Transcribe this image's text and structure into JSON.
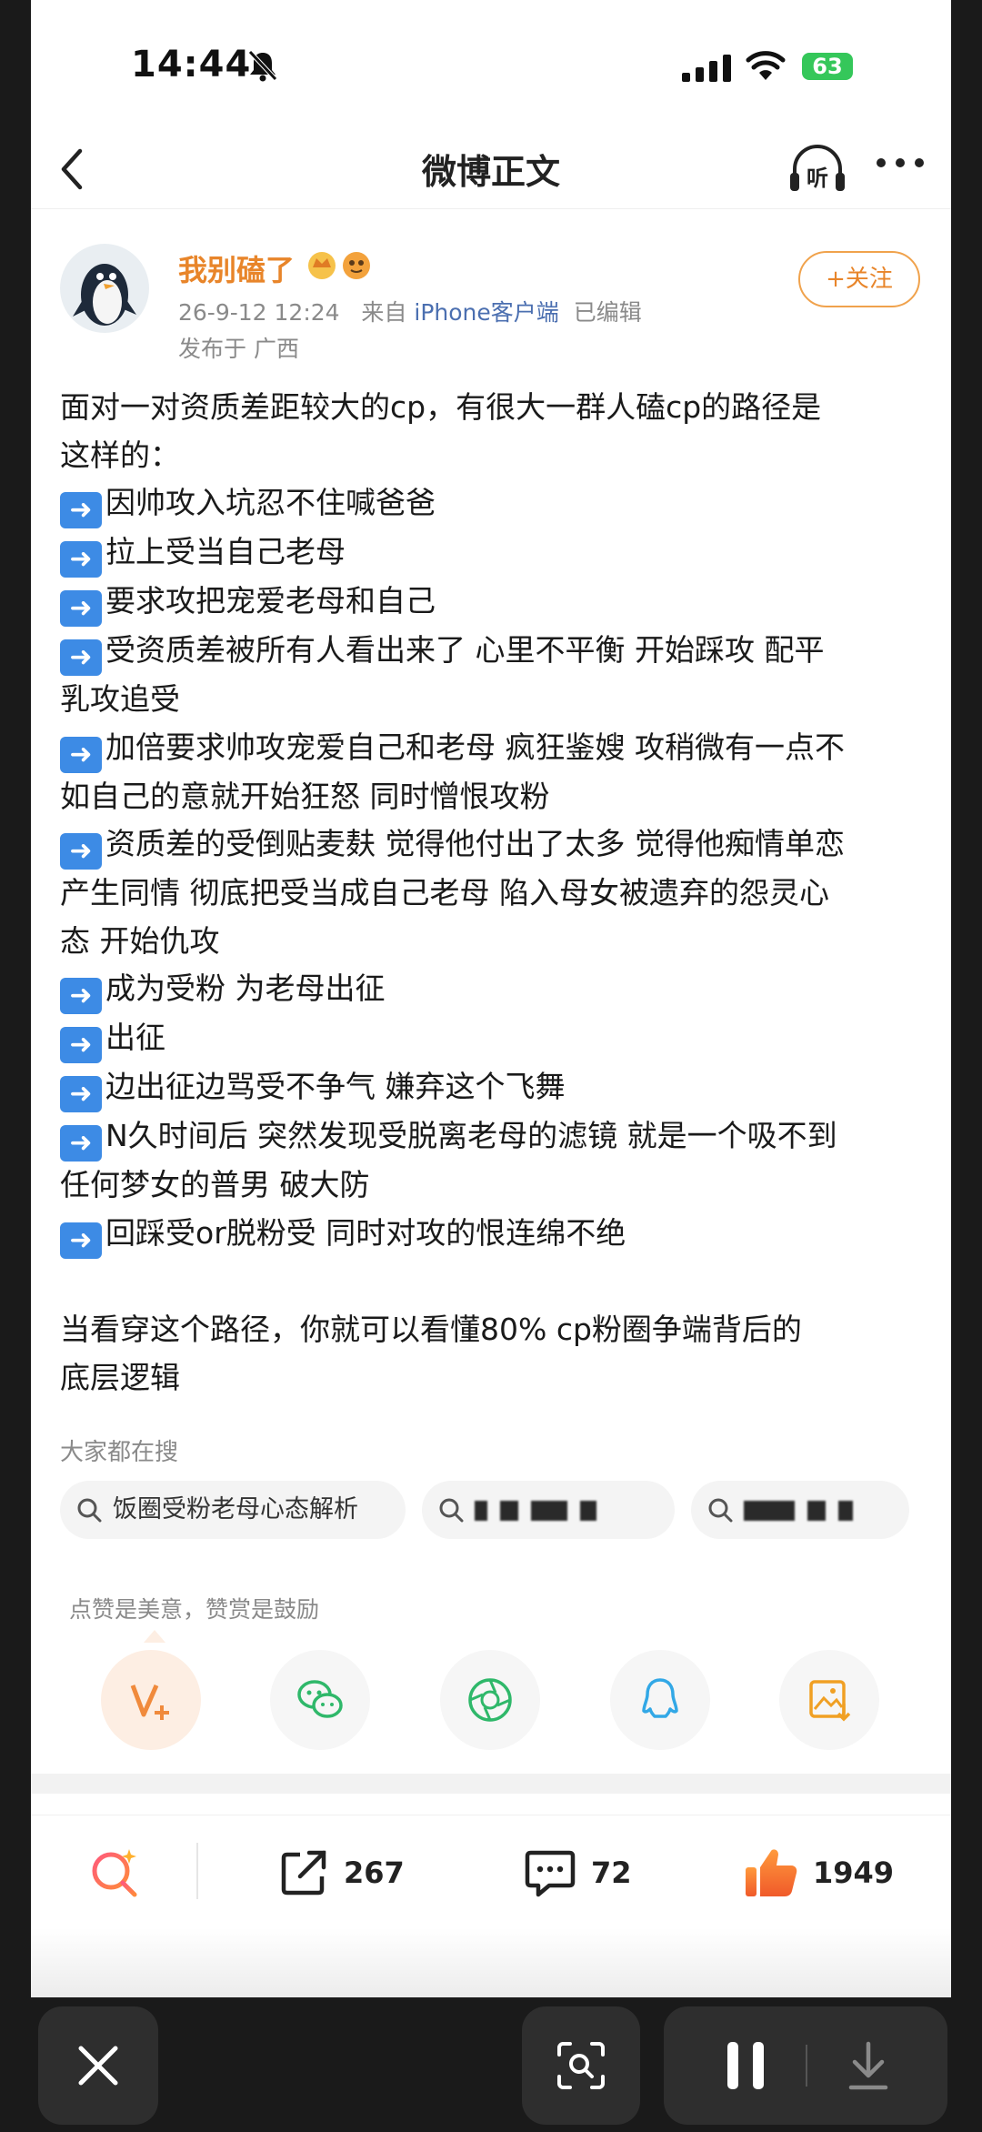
{
  "status_bar": {
    "time": "14:44",
    "battery": "63"
  },
  "nav": {
    "title": "微博正文",
    "listen_label": "听"
  },
  "post": {
    "author": "我别磕了",
    "date": "26-9-12 12:24",
    "source_prefix": "来自",
    "source": "iPhone客户端",
    "edited": "已编辑",
    "location": "发布于 广西",
    "follow_label": "+关注",
    "body": {
      "intro_1": "面对一对资质差距较大的cp，有很大一群人磕cp的路径是",
      "intro_2": "这样的：",
      "step_1": "因帅攻入坑忍不住喊爸爸",
      "step_2": "拉上受当自己老母",
      "step_3": "要求攻把宠爱老母和自己",
      "step_4a": "受资质差被所有人看出来了 心里不平衡 开始踩攻 配平",
      "step_4b": "乳攻追受",
      "step_5a": "加倍要求帅攻宠爱自己和老母 疯狂鉴嫂 攻稍微有一点不",
      "step_5b": "如自己的意就开始狂怒 同时憎恨攻粉",
      "step_6a": "资质差的受倒贴麦麸 觉得他付出了太多 觉得他痴情单恋",
      "step_6b": "产生同情 彻底把受当成自己老母 陷入母女被遗弃的怨灵心",
      "step_6c": "态 开始仇攻",
      "step_7": "成为受粉 为老母出征",
      "step_8": "出征",
      "step_9": "边出征边骂受不争气 嫌弃这个飞舞",
      "step_10a": "N久时间后 突然发现受脱离老母的滤镜 就是一个吸不到",
      "step_10b": "任何梦女的普男 破大防",
      "step_11": "回踩受or脱粉受 同时对攻的恨连绵不绝",
      "outro_1": "当看穿这个路径，你就可以看懂80% cp粉圈争端背后的",
      "outro_2": "底层逻辑"
    }
  },
  "search": {
    "title": "大家都在搜",
    "chips": [
      "饭圈受粉老母心态解析"
    ]
  },
  "reward_hint": "点赞是美意，赞赏是鼓励",
  "share_icons": [
    "reward-icon",
    "wechat-icon",
    "moments-icon",
    "qq-icon",
    "save-image-icon"
  ],
  "actions": {
    "repost": "267",
    "comments": "72",
    "likes": "1949"
  },
  "colors": {
    "accent": "#e8852a",
    "link": "#4b6fb0",
    "arrow": "#3d8be5"
  }
}
